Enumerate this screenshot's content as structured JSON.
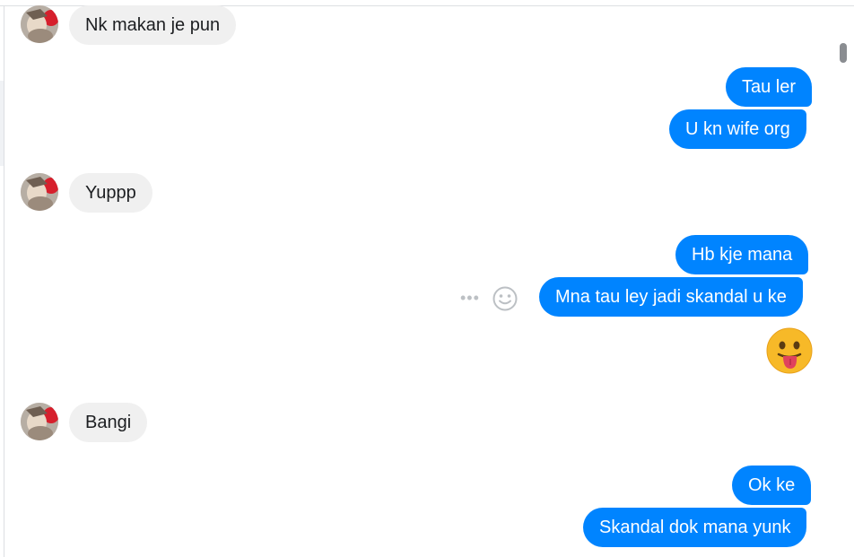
{
  "messages": [
    {
      "sender": "other",
      "text": "Nk makan je pun"
    },
    {
      "sender": "me",
      "text": "Tau ler"
    },
    {
      "sender": "me",
      "text": "U kn wife org"
    },
    {
      "sender": "other",
      "text": "Yuppp"
    },
    {
      "sender": "me",
      "text": "Hb kje mana"
    },
    {
      "sender": "me",
      "text": "Mna tau ley jadi skandal u ke"
    },
    {
      "sender": "me",
      "text": "",
      "emoji": "tongue-out-emoji"
    },
    {
      "sender": "other",
      "text": "Bangi"
    },
    {
      "sender": "me",
      "text": "Ok ke"
    },
    {
      "sender": "me",
      "text": "Skandal dok mana yunk"
    }
  ],
  "message_actions": {
    "more": "•••",
    "react_icon": "smiley-icon"
  },
  "colors": {
    "outgoing": "#0084ff",
    "incoming": "#f0f0f0",
    "accent": "#0084ff"
  }
}
